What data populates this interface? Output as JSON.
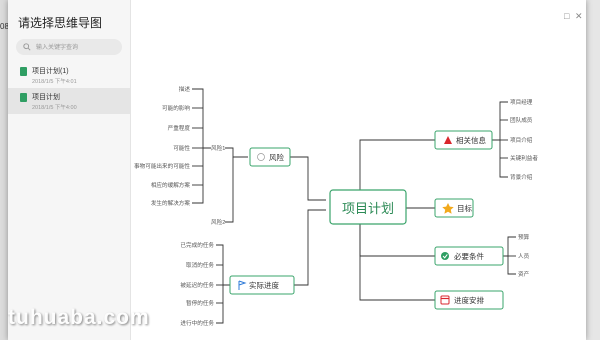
{
  "dialog": {
    "title": "请选择思维导图",
    "search_placeholder": "输入关键字查询",
    "files": [
      {
        "name": "项目计划(1)",
        "date": "2018/1/5  下午4:01"
      },
      {
        "name": "项目计划",
        "date": "2018/1/5  下午4:00"
      }
    ]
  },
  "background": {
    "left_fragment": "08"
  },
  "mindmap": {
    "central": "项目计划",
    "risk": {
      "label": "风险",
      "sub1": "风险1",
      "sub2": "风险2",
      "items": [
        "描述",
        "可能的影响",
        "严重程度",
        "可能性",
        "事物可能出来的可能性",
        "相应的缓解方案",
        "发生的解决方案"
      ]
    },
    "progress": {
      "label": "实际进度",
      "items": [
        "已完成的任务",
        "取消的任务",
        "被延迟的任务",
        "暂停的任务",
        "进行中的任务"
      ]
    },
    "related": {
      "label": "相关信息",
      "items": [
        "项目经理",
        "团队成员",
        "项目介绍",
        "关键利益者",
        "背景介绍"
      ]
    },
    "goal": {
      "label": "目标"
    },
    "conditions": {
      "label": "必要条件",
      "items": [
        "预算",
        "人员",
        "资产"
      ]
    },
    "schedule": {
      "label": "进度安排"
    }
  },
  "watermark": "tuhuaba.com",
  "colors": {
    "accent": "#2f9e63",
    "warning": "#d9262c",
    "star": "#f2a91c"
  }
}
